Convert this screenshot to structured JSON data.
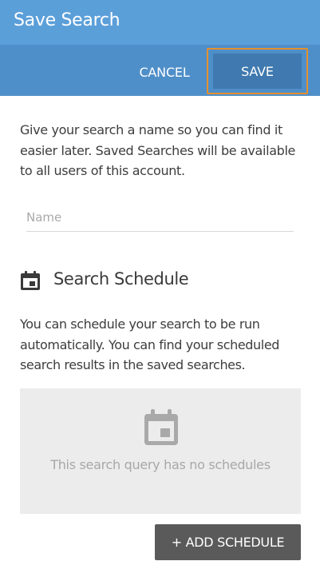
{
  "dialog": {
    "title": "Save Search"
  },
  "actions": {
    "cancel_label": "CANCEL",
    "save_label": "SAVE"
  },
  "intro": {
    "text": "Give your search a name so you can find it easier later. Saved Searches will be available to all users of this account."
  },
  "name_field": {
    "placeholder": "Name",
    "value": ""
  },
  "schedule": {
    "heading": "Search Schedule",
    "heading_icon": "calendar-icon",
    "description": "You can schedule your search to be run automatically. You can find your scheduled search results in the saved searches.",
    "empty_icon": "calendar-icon",
    "empty_text": "This search query has no schedules",
    "add_label": "+ ADD SCHEDULE"
  },
  "colors": {
    "title_bar": "#5b9fd9",
    "action_bar": "#4f8fc9",
    "save_button": "#3f79af",
    "focus_ring": "#e5902e",
    "add_button": "#5a5a5a",
    "empty_panel": "#ececec"
  }
}
